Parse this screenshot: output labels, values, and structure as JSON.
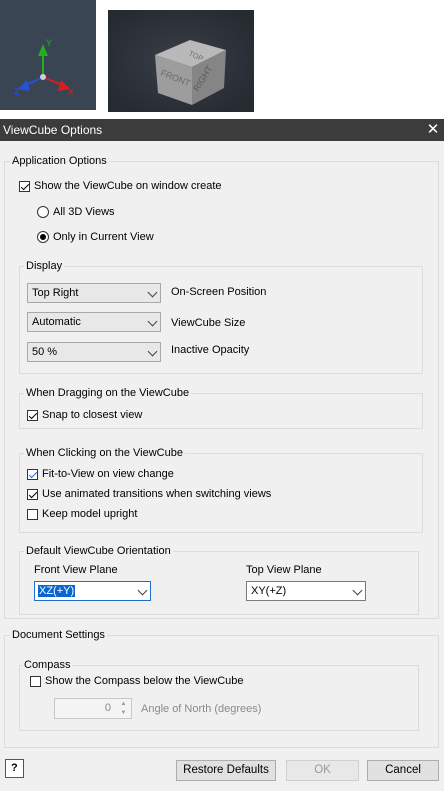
{
  "dialog": {
    "title": "ViewCube Options",
    "close_glyph": "✕"
  },
  "cube_faces": {
    "top": "TOP",
    "front": "FRONT",
    "right": "RIGHT"
  },
  "application_options": {
    "legend": "Application Options",
    "show_on_create": {
      "label": "Show the ViewCube on window create",
      "checked": true
    },
    "all_3d_views": {
      "label": "All 3D Views",
      "selected": false
    },
    "only_current_view": {
      "label": "Only in Current View",
      "selected": true
    }
  },
  "display": {
    "legend": "Display",
    "position": {
      "value": "Top Right",
      "label": "On-Screen Position"
    },
    "size": {
      "value": "Automatic",
      "label": "ViewCube Size"
    },
    "opacity": {
      "value": "50 %",
      "label": "Inactive Opacity"
    }
  },
  "dragging": {
    "legend": "When Dragging on the ViewCube",
    "snap": {
      "label": "Snap to closest view",
      "checked": true
    }
  },
  "clicking": {
    "legend": "When Clicking on the ViewCube",
    "fit_to_view": {
      "label": "Fit-to-View on view change",
      "checked": true
    },
    "animated": {
      "label": "Use animated transitions when switching views",
      "checked": true
    },
    "upright": {
      "label": "Keep model upright",
      "checked": false
    }
  },
  "orientation": {
    "legend": "Default ViewCube Orientation",
    "front_label": "Front View Plane",
    "front_value": "XZ(+Y)",
    "top_label": "Top View Plane",
    "top_value": "XY(+Z)"
  },
  "document_settings": {
    "legend": "Document Settings",
    "compass": {
      "legend": "Compass",
      "show": {
        "label": "Show the Compass below the ViewCube",
        "checked": false
      },
      "angle_value": "0",
      "angle_label": "Angle of North (degrees)"
    }
  },
  "buttons": {
    "help": "?",
    "restore": "Restore Defaults",
    "ok": "OK",
    "cancel": "Cancel"
  },
  "colors": {
    "axis_x": "#d81e1e",
    "axis_y": "#22b022",
    "axis_z": "#2a4fd8",
    "titlebar": "#3c3c3c",
    "accent": "#1e6fd0"
  }
}
